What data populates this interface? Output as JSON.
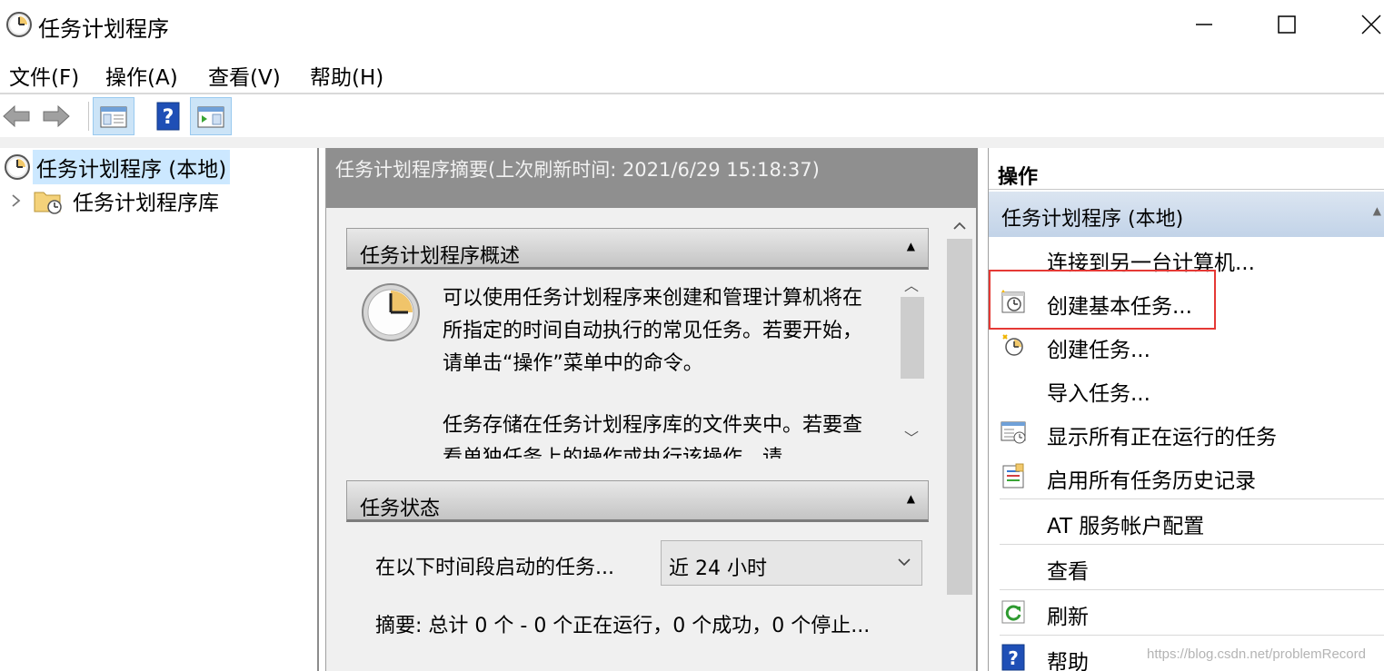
{
  "window": {
    "title": "任务计划程序"
  },
  "menu": [
    {
      "label": "文件(F)"
    },
    {
      "label": "操作(A)"
    },
    {
      "label": "查看(V)"
    },
    {
      "label": "帮助(H)"
    }
  ],
  "tree": {
    "root_label": "任务计划程序 (本地)",
    "child_label": "任务计划程序库"
  },
  "middle": {
    "header": "任务计划程序摘要(上次刷新时间: 2021/6/29 15:18:37)",
    "overview": {
      "title": "任务计划程序概述",
      "para1": "可以使用任务计划程序来创建和管理计算机将在所指定的时间自动执行的常见任务。若要开始，请单击“操作”菜单中的命令。",
      "para2": "任务存储在任务计划程序库的文件夹中。若要查看单独任务上的操作或执行该操作，请"
    },
    "status": {
      "title": "任务状态",
      "range_label": "在以下时间段启动的任务...",
      "range_value": "近 24 小时",
      "summary": "摘要: 总计 0 个 - 0 个正在运行，0 个成功，0 个停止..."
    }
  },
  "actions": {
    "header": "操作",
    "section": "任务计划程序 (本地)",
    "items": [
      {
        "label": "连接到另一台计算机...",
        "icon": "none"
      },
      {
        "label": "创建基本任务...",
        "icon": "basic-task-icon"
      },
      {
        "label": "创建任务...",
        "icon": "create-task-icon"
      },
      {
        "label": "导入任务...",
        "icon": "none"
      },
      {
        "label": "显示所有正在运行的任务",
        "icon": "running-tasks-icon"
      },
      {
        "label": "启用所有任务历史记录",
        "icon": "history-icon"
      },
      {
        "label": "AT 服务帐户配置",
        "icon": "none"
      },
      {
        "label": "查看",
        "icon": "none"
      },
      {
        "label": "刷新",
        "icon": "refresh-icon"
      },
      {
        "label": "帮助",
        "icon": "help-icon"
      }
    ]
  },
  "watermark": "https://blog.csdn.net/problemRecord",
  "colors": {
    "selection": "#cce8ff",
    "header_gray": "#8f8f8f",
    "highlight": "#e53935",
    "action_section": "#c2d3e8"
  }
}
